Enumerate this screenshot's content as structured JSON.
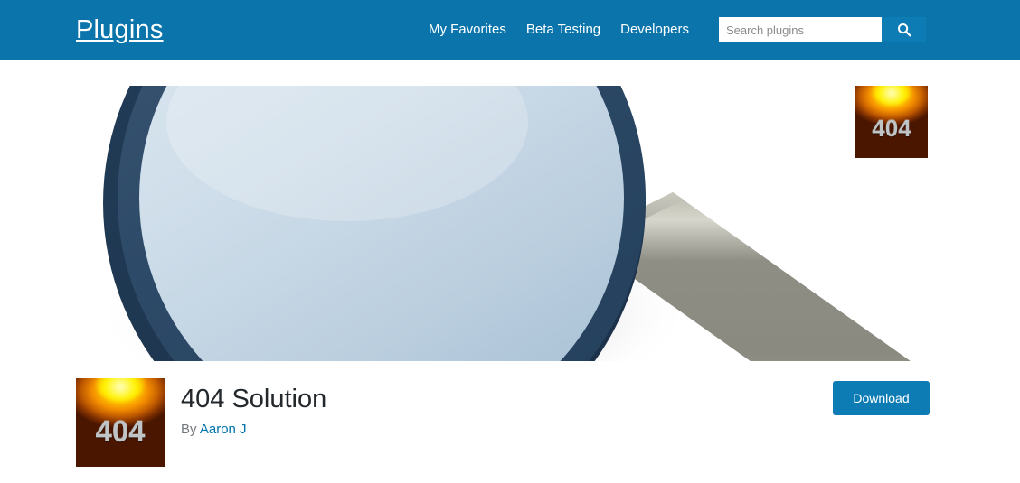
{
  "header": {
    "brand": "Plugins",
    "nav": [
      {
        "label": "My Favorites",
        "name": "nav-my-favorites"
      },
      {
        "label": "Beta Testing",
        "name": "nav-beta-testing"
      },
      {
        "label": "Developers",
        "name": "nav-developers"
      }
    ],
    "search": {
      "placeholder": "Search plugins",
      "value": "",
      "button_icon": "search-icon"
    },
    "background_color": "#0b75ab"
  },
  "banner": {
    "alt": "magnifying-glass-illustration",
    "lens_rim_color": "#2e4f70",
    "lens_glass_color": "#c5d8e6",
    "handle_color": "#9a9a8e",
    "background_color": "#ffffff"
  },
  "thumbnail": {
    "icon_text": "404",
    "name": "plugin-thumbnail-404"
  },
  "plugin": {
    "icon_text": "404",
    "title": "404 Solution",
    "by_label": "By",
    "author": "Aaron J",
    "download_label": "Download",
    "download_color": "#0e7cb4",
    "title_color": "#23282d",
    "link_color": "#0073aa"
  }
}
